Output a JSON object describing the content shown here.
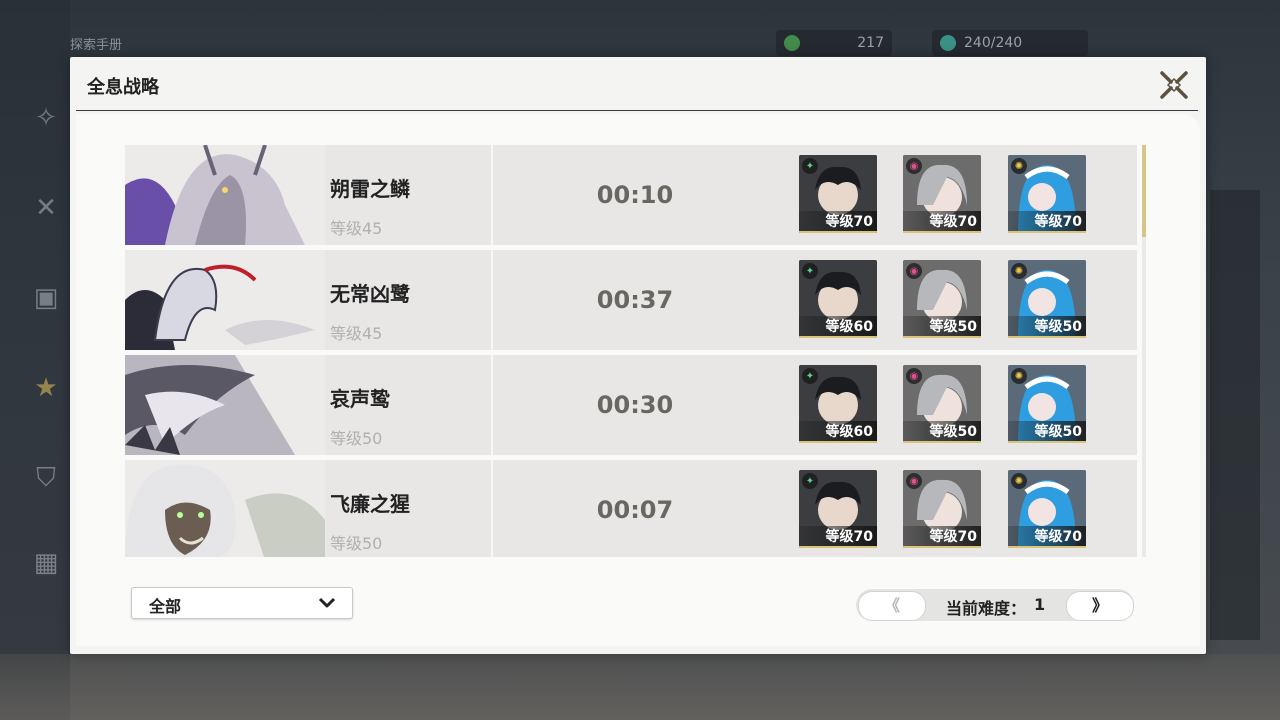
{
  "background": {
    "top_left_label": "探索手册",
    "resource_1": "217",
    "resource_2": "240/240"
  },
  "modal": {
    "title": "全息战略"
  },
  "rows": [
    {
      "name": "朔雷之鳞",
      "level": "等级45",
      "time": "00:10",
      "team": [
        {
          "element": "green-icon",
          "level": "等级70"
        },
        {
          "element": "pink-icon",
          "level": "等级70"
        },
        {
          "element": "yellow-icon",
          "level": "等级70"
        }
      ]
    },
    {
      "name": "无常凶鹭",
      "level": "等级45",
      "time": "00:37",
      "team": [
        {
          "element": "green-icon",
          "level": "等级60"
        },
        {
          "element": "pink-icon",
          "level": "等级50"
        },
        {
          "element": "yellow-icon",
          "level": "等级50"
        }
      ]
    },
    {
      "name": "哀声鸷",
      "level": "等级50",
      "time": "00:30",
      "team": [
        {
          "element": "green-icon",
          "level": "等级60"
        },
        {
          "element": "pink-icon",
          "level": "等级50"
        },
        {
          "element": "yellow-icon",
          "level": "等级50"
        }
      ]
    },
    {
      "name": "飞廉之猩",
      "level": "等级50",
      "time": "00:07",
      "team": [
        {
          "element": "green-icon",
          "level": "等级70"
        },
        {
          "element": "pink-icon",
          "level": "等级70"
        },
        {
          "element": "yellow-icon",
          "level": "等级70"
        }
      ]
    }
  ],
  "filter": {
    "label": "全部"
  },
  "pager": {
    "prev": "《",
    "label": "当前难度：",
    "value": "1",
    "next": "》"
  },
  "colors": {
    "accent": "#d6c788",
    "time": "#6a6762",
    "level": "#b0b0ae"
  }
}
